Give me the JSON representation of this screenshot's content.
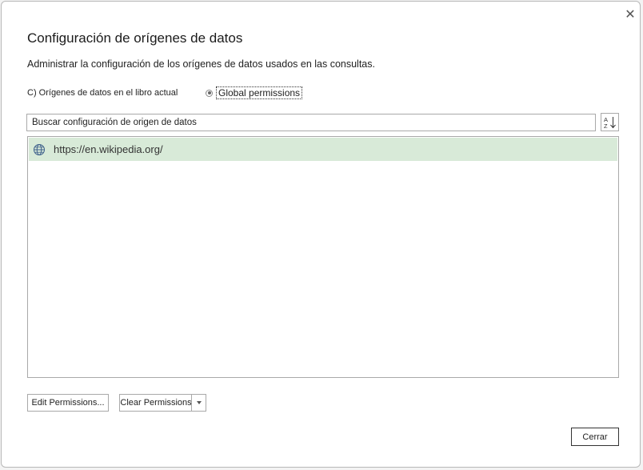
{
  "dialog": {
    "title": "Configuración de orígenes de datos",
    "description": "Administrar la configuración de los orígenes de datos usados en las consultas.",
    "close_glyph": "✕"
  },
  "scope": {
    "current_workbook_label": "C) Orígenes de datos en el libro actual",
    "global_label": "Global permissions",
    "selected": "global"
  },
  "search": {
    "placeholder": "Buscar configuración de origen de datos"
  },
  "sort": {
    "icon": "sort-az-icon"
  },
  "sources": [
    {
      "label": "https://en.wikipedia.org/",
      "icon": "globe-icon",
      "selected": true
    }
  ],
  "buttons": {
    "edit_permissions": "Edit Permissions...",
    "clear_permissions": "Clear Permissions",
    "close": "Cerrar"
  },
  "colors": {
    "selected_row": "#d8ead8",
    "border": "#a9a9a9"
  }
}
